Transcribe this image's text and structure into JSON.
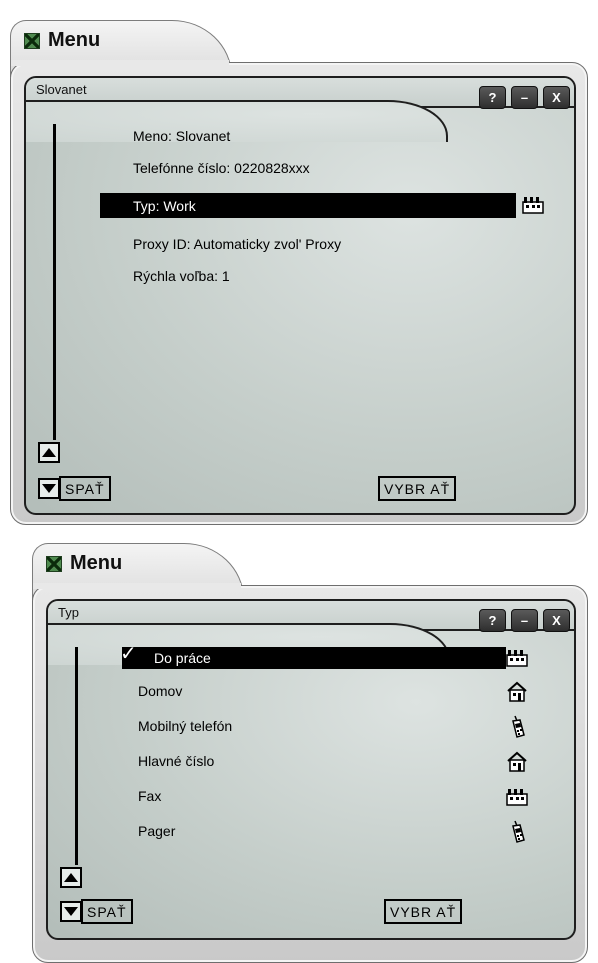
{
  "windows": [
    {
      "title": "Menu",
      "screen_title": "Slovanet",
      "controls": [
        "?",
        "–",
        "X"
      ],
      "items": [
        {
          "label": "Meno: Slovanet",
          "selected": false
        },
        {
          "label": "Telefónne číslo: 0220828xxx",
          "selected": false
        },
        {
          "label": "Typ: Work",
          "selected": true,
          "icon": "factory-icon"
        },
        {
          "label": "Proxy ID: Automaticky zvol' Proxy",
          "selected": false
        },
        {
          "label": "Rýchla voľba: 1",
          "selected": false
        }
      ],
      "back_label": "SPAŤ",
      "select_label": "VYBR AŤ"
    },
    {
      "title": "Menu",
      "screen_title": "Typ",
      "controls": [
        "?",
        "–",
        "X"
      ],
      "items": [
        {
          "label": "Do práce",
          "selected": true,
          "checked": true,
          "icon": "factory-icon"
        },
        {
          "label": "Domov",
          "selected": false,
          "icon": "house-icon"
        },
        {
          "label": "Mobilný telefón",
          "selected": false,
          "icon": "mobile-phone-icon"
        },
        {
          "label": "Hlavné číslo",
          "selected": false,
          "icon": "house-icon"
        },
        {
          "label": "Fax",
          "selected": false,
          "icon": "factory-icon"
        },
        {
          "label": "Pager",
          "selected": false,
          "icon": "mobile-phone-icon"
        }
      ],
      "back_label": "SPAŤ",
      "select_label": "VYBR AŤ"
    }
  ]
}
